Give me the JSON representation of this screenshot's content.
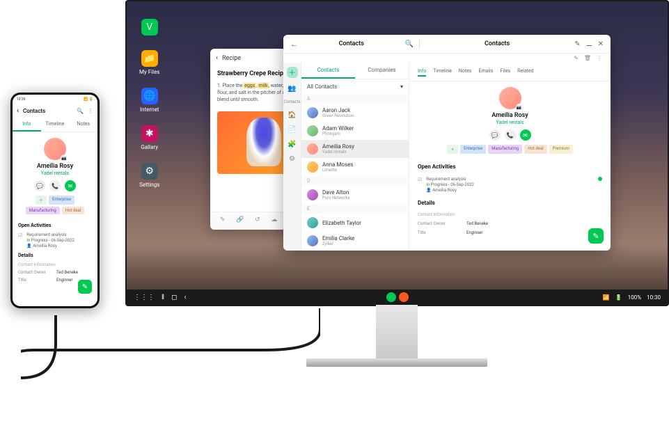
{
  "desktop": {
    "icons": [
      {
        "label": "V",
        "name": ""
      },
      {
        "label": "📁",
        "name": "My Files"
      },
      {
        "label": "🌐",
        "name": "Internet"
      },
      {
        "label": "✱",
        "name": "Gallary"
      },
      {
        "label": "⚙",
        "name": "Settings"
      }
    ]
  },
  "recipe": {
    "nav": "Recipe",
    "title": "Strawberry Crepe Recipe",
    "step_prefix": "1. Place the ",
    "hl1": "eggs",
    "sep1": ", ",
    "hl2": "milk",
    "step_mid": ", water, melted butter, flour, and salt in the pitcher of a blender; blend until smooth.",
    "tools": [
      "✎",
      "🔗",
      "↺",
      "☁",
      "⤴",
      "⋮"
    ]
  },
  "app": {
    "title_left": "Contacts",
    "title_right": "Contacts",
    "search_icon": "🔍",
    "win_icons": [
      "✎",
      "⚊",
      "✕"
    ],
    "more_icons": [
      "✎",
      "🗑",
      "⋮"
    ],
    "sidebar_first": "Contacts",
    "sidebar_items": [
      "👥",
      "🏠",
      "📄",
      "🧩",
      "⚙"
    ],
    "subtabs": [
      "Contacts",
      "Companies"
    ],
    "filter": "All Contacts",
    "filter_chevron": "▾",
    "sections": {
      "A": [
        {
          "name": "Aaron Jack",
          "sub": "Green Revolution"
        },
        {
          "name": "Adam Wilker",
          "sub": "Photojam"
        },
        {
          "name": "Ameilia Rosy",
          "sub": "Yadel rentals"
        },
        {
          "name": "Anna Moses",
          "sub": "Limelite"
        }
      ],
      "D": [
        {
          "name": "Dave Alton",
          "sub": "Puro Networks"
        }
      ],
      "E": [
        {
          "name": "Elizabeth Taylor",
          "sub": ""
        },
        {
          "name": "Emilia Clarke",
          "sub": "Zylker"
        }
      ]
    },
    "detail_tabs": [
      "Info",
      "Timeline",
      "Notes",
      "Emails",
      "Files",
      "Related"
    ],
    "profile": {
      "name": "Ameilia Rosy",
      "company": "Yadel rentals",
      "actions": [
        "💬",
        "📞",
        "✉"
      ],
      "tags": [
        "＋",
        "Enterprise",
        "Manufacturing",
        "Hot deal",
        "Premium"
      ]
    },
    "activity": {
      "header": "Open Activities",
      "item": {
        "title": "Requirement analysis",
        "line2": "In Progress - 06-Sep-2022",
        "line3": "👤 Ameilia Rosy"
      }
    },
    "details": {
      "header": "Details",
      "sub": "Contact Information",
      "rows": [
        {
          "k": "Contact Owner",
          "v": "Ted Beneke"
        },
        {
          "k": "Title",
          "v": "Enginner"
        }
      ]
    },
    "fab": "✎"
  },
  "taskbar": {
    "left": [
      "⋮⋮⋮",
      "‖",
      "◻",
      "‹"
    ],
    "battery": "100%",
    "time": "10:30",
    "wifi": "📶",
    "batt": "🔋"
  },
  "phone": {
    "status_left": "10:30",
    "status_right": "📶 🔋",
    "title": "Contacts",
    "head_icons": [
      "🔍",
      "⋮"
    ],
    "tabs": [
      "Info",
      "Timeline",
      "Notes"
    ],
    "profile": {
      "name": "Ameilia Rosy",
      "company": "Yadel rentals",
      "actions": [
        "💬",
        "📞",
        "✉"
      ],
      "tags": [
        "＋",
        "Enterprise",
        "Manufacturing",
        "Hot deal"
      ]
    },
    "activity": {
      "header": "Open Activities",
      "item": {
        "title": "Requirement analysis",
        "line2": "In Progress - 06-Sep-2022",
        "line3": "👤 Ameilia Rosy"
      }
    },
    "details": {
      "header": "Details",
      "sub": "Contact Information",
      "rows": [
        {
          "k": "Contact Owner",
          "v": "Ted Beneke"
        },
        {
          "k": "Title",
          "v": "Enginner"
        }
      ]
    }
  }
}
